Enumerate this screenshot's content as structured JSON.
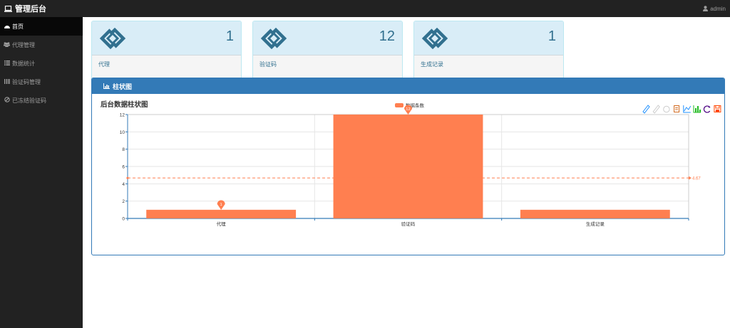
{
  "app": {
    "title": "管理后台",
    "user": "admin"
  },
  "sidebar": {
    "items": [
      {
        "label": "首页",
        "icon": "dashboard-icon",
        "active": true
      },
      {
        "label": "代理管理",
        "icon": "users-icon",
        "active": false
      },
      {
        "label": "数据统计",
        "icon": "list-icon",
        "active": false
      },
      {
        "label": "验证码管理",
        "icon": "barcode-icon",
        "active": false
      },
      {
        "label": "已冻结验证码",
        "icon": "ban-icon",
        "active": false
      }
    ]
  },
  "stats": [
    {
      "value": "1",
      "label": "代理",
      "icon": "link-logo-icon"
    },
    {
      "value": "12",
      "label": "验证码",
      "icon": "link-logo-icon"
    },
    {
      "value": "1",
      "label": "生成记录",
      "icon": "link-logo-icon"
    }
  ],
  "panel": {
    "title": "柱状图",
    "icon": "bar-chart-icon"
  },
  "toolbar": {
    "icons": [
      "mark-icon",
      "erase-mark-icon",
      "data-view-icon",
      "switch-line-icon",
      "switch-bar-icon",
      "restore-icon",
      "save-image-icon",
      "magic-icon"
    ]
  },
  "chart_data": {
    "type": "bar",
    "title": "后台数据柱状图",
    "categories": [
      "代理",
      "验证码",
      "生成记录"
    ],
    "series": [
      {
        "name": "数据条数",
        "values": [
          1,
          12,
          1
        ],
        "color": "#ff7f50"
      }
    ],
    "ylim": [
      0,
      12
    ],
    "yticks": [
      0,
      2,
      4,
      6,
      8,
      10,
      12
    ],
    "mark_points": [
      {
        "category": "代理",
        "value": 1,
        "label": "1"
      },
      {
        "category": "验证码",
        "value": 12,
        "label": "12"
      }
    ],
    "mark_line": {
      "type": "average",
      "value": 4.67,
      "label": "4.67"
    },
    "legend_position": "top-center",
    "grid": true
  }
}
